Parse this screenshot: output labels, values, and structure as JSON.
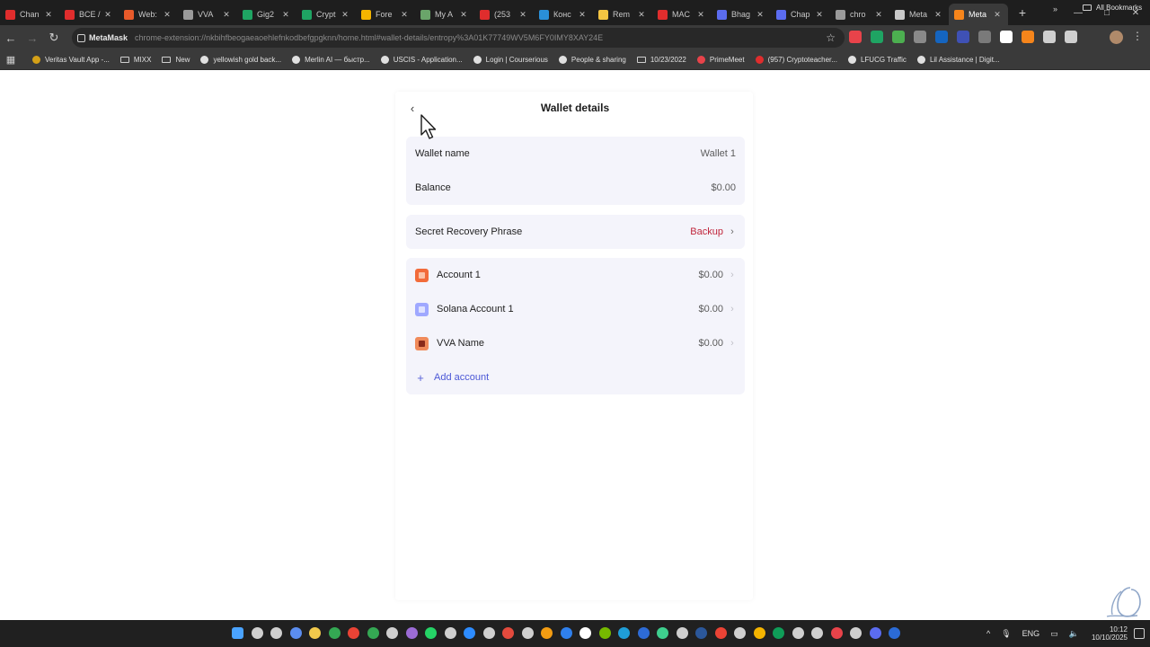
{
  "browser": {
    "tabs": [
      {
        "label": "Chan",
        "color": "#e02d2d"
      },
      {
        "label": "BCE /",
        "color": "#e02d2d"
      },
      {
        "label": "Web:",
        "color": "#e85a2a"
      },
      {
        "label": "VVA",
        "color": "#9a9a9a"
      },
      {
        "label": "Gig2",
        "color": "#1fa463"
      },
      {
        "label": "Crypt",
        "color": "#1fa463"
      },
      {
        "label": "Fore",
        "color": "#f4b400"
      },
      {
        "label": "My A",
        "color": "#6aa56a"
      },
      {
        "label": "(253",
        "color": "#e02d2d"
      },
      {
        "label": "Конс",
        "color": "#2a8fd8"
      },
      {
        "label": "Rem",
        "color": "#f4c542"
      },
      {
        "label": "MAC",
        "color": "#e02d2d"
      },
      {
        "label": "Bhag",
        "color": "#5b6cf0"
      },
      {
        "label": "Chap",
        "color": "#5b6cf0"
      },
      {
        "label": "chro",
        "color": "#9a9a9a"
      },
      {
        "label": "Meta",
        "color": "#c9c9c9"
      },
      {
        "label": "Meta",
        "color": "#f6851b",
        "active": true
      }
    ],
    "new_tab": "+",
    "window_controls": {
      "minimize": "—",
      "maximize": "□",
      "close": "✕"
    },
    "nav": {
      "back": "←",
      "forward": "→",
      "reload": "↻"
    },
    "address": {
      "chip": "MetaMask",
      "url": "chrome-extension://nkbihfbeogaeaoehlefnkodbefgpgknn/home.html#wallet-details/entropy%3A01K77749WV5M6FY0IMY8XAY24E"
    },
    "extension_colors": [
      "#e8434a",
      "#1fa463",
      "#4caf50",
      "#8a8a8a",
      "#1565c0",
      "#3f51b5",
      "#7a7a7a",
      "#ffffff",
      "#f6851b",
      "#cfcfcf",
      "#cfcfcf"
    ],
    "bookmarks": [
      {
        "label": "Veritas Vault App -...",
        "icon": "#d4a017"
      },
      {
        "label": "MIXX",
        "icon": "folder"
      },
      {
        "label": "New",
        "icon": "folder"
      },
      {
        "label": "yellowish gold back...",
        "icon": "#e0e0e0"
      },
      {
        "label": "Merlin AI — быстр...",
        "icon": "#e0e0e0"
      },
      {
        "label": "USCIS - Application...",
        "icon": "#e0e0e0"
      },
      {
        "label": "Login | Courserious",
        "icon": "#e0e0e0"
      },
      {
        "label": "People & sharing",
        "icon": "#e0e0e0"
      },
      {
        "label": "10/23/2022",
        "icon": "folder"
      },
      {
        "label": "PrimeMeet",
        "icon": "#e8434a"
      },
      {
        "label": "(957) Cryptoteacher...",
        "icon": "#e02d2d"
      },
      {
        "label": "LFUCG Traffic",
        "icon": "#e0e0e0"
      },
      {
        "label": "Lil Assistance | Digit...",
        "icon": "#e0e0e0"
      }
    ],
    "bookmarks_more": "»",
    "all_bookmarks": "All Bookmarks"
  },
  "wallet_details": {
    "title": "Wallet details",
    "back_icon": "‹",
    "info": {
      "name_label": "Wallet name",
      "name_value": "Wallet 1",
      "balance_label": "Balance",
      "balance_value": "$0.00"
    },
    "srp": {
      "label": "Secret Recovery Phrase",
      "action": "Backup",
      "action_color": "#c0253b"
    },
    "accounts": [
      {
        "name": "Account 1",
        "balance": "$0.00",
        "icon_bg": "#f26b3a",
        "icon_fg": "#fbc3a8"
      },
      {
        "name": "Solana Account 1",
        "balance": "$0.00",
        "icon_bg": "#9fa8ff",
        "icon_fg": "#dfe2ff"
      },
      {
        "name": "VVA Name",
        "balance": "$0.00",
        "icon_bg": "#f08a5a",
        "icon_fg": "#8a2a1a"
      }
    ],
    "add_account": "Add account",
    "add_icon": "+",
    "chevron": "›"
  },
  "taskbar": {
    "icon_colors": [
      "#4aa3ff",
      "#cfcfcf",
      "#cfcfcf",
      "#5b8def",
      "#f2c94c",
      "#34a853",
      "#ea4335",
      "#34a853",
      "#cfcfcf",
      "#9b6bd6",
      "#25d366",
      "#cfcfcf",
      "#2d8cff",
      "#cfcfcf",
      "#e34a3d",
      "#cfcfcf",
      "#f39c12",
      "#2f80ed",
      "#ffffff",
      "#76b900",
      "#1f9ed8",
      "#2d6bd6",
      "#3ecf8e",
      "#cfcfcf",
      "#2b579a",
      "#ea4335",
      "#cfcfcf",
      "#f4b400",
      "#0f9d58",
      "#cfcfcf",
      "#cfcfcf",
      "#e8434a",
      "#cfcfcf",
      "#5b6cf0",
      "#2b6bd6"
    ],
    "tray_up": "^",
    "mic": "🎙",
    "language": "ENG",
    "network": "▭",
    "volume": "🔈",
    "time": "10:12",
    "date": "10/10/2025"
  }
}
